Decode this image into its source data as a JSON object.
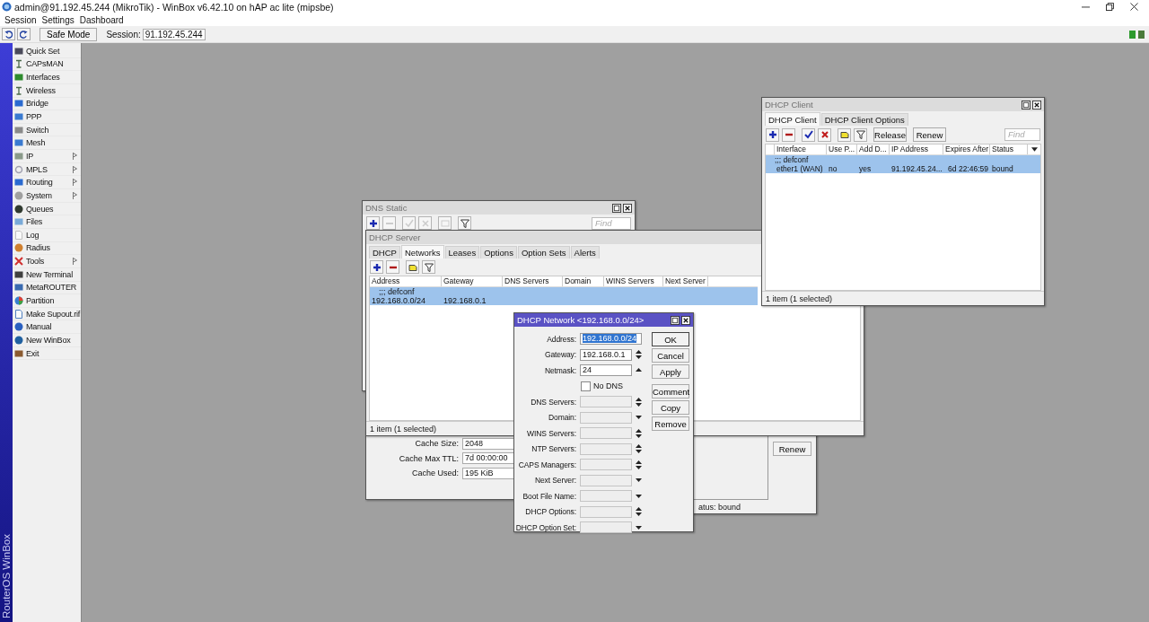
{
  "app": {
    "title": "admin@91.192.45.244 (MikroTik) - WinBox v6.42.10 on hAP ac lite (mipsbe)",
    "menu": [
      "Session",
      "Settings",
      "Dashboard"
    ]
  },
  "toolbar": {
    "safe_mode": "Safe Mode",
    "session_label": "Session:",
    "session": "91.192.45.244"
  },
  "sidebar": {
    "brand": "RouterOS WinBox",
    "items": [
      {
        "label": "Quick Set",
        "submenu": false
      },
      {
        "label": "CAPsMAN",
        "submenu": false
      },
      {
        "label": "Interfaces",
        "submenu": false
      },
      {
        "label": "Wireless",
        "submenu": false
      },
      {
        "label": "Bridge",
        "submenu": false
      },
      {
        "label": "PPP",
        "submenu": false
      },
      {
        "label": "Switch",
        "submenu": false
      },
      {
        "label": "Mesh",
        "submenu": false
      },
      {
        "label": "IP",
        "submenu": true
      },
      {
        "label": "MPLS",
        "submenu": true
      },
      {
        "label": "Routing",
        "submenu": true
      },
      {
        "label": "System",
        "submenu": true
      },
      {
        "label": "Queues",
        "submenu": false
      },
      {
        "label": "Files",
        "submenu": false
      },
      {
        "label": "Log",
        "submenu": false
      },
      {
        "label": "Radius",
        "submenu": false
      },
      {
        "label": "Tools",
        "submenu": true
      },
      {
        "label": "New Terminal",
        "submenu": false
      },
      {
        "label": "MetaROUTER",
        "submenu": false
      },
      {
        "label": "Partition",
        "submenu": false
      },
      {
        "label": "Make Supout.rif",
        "submenu": false
      },
      {
        "label": "Manual",
        "submenu": false
      },
      {
        "label": "New WinBox",
        "submenu": false
      },
      {
        "label": "Exit",
        "submenu": false
      }
    ]
  },
  "dns_static": {
    "title": "DNS Static",
    "active": false,
    "find_placeholder": "Find"
  },
  "dns_settings": {
    "fields": [
      {
        "label": "Cache Size:",
        "value": "2048"
      },
      {
        "label": "Cache Max TTL:",
        "value": "7d 00:00:00"
      },
      {
        "label": "Cache Used:",
        "value": "195 KiB"
      }
    ]
  },
  "client_detail": {
    "button": "Renew",
    "status": "atus: bound"
  },
  "dhcp_server": {
    "title": "DHCP Server",
    "active": false,
    "tabs": [
      {
        "label": "DHCP",
        "selected": false
      },
      {
        "label": "Networks",
        "selected": true
      },
      {
        "label": "Leases",
        "selected": false
      },
      {
        "label": "Options",
        "selected": false
      },
      {
        "label": "Option Sets",
        "selected": false
      },
      {
        "label": "Alerts",
        "selected": false
      }
    ],
    "columns": [
      "Address",
      "Gateway",
      "DNS Servers",
      "Domain",
      "WINS Servers",
      "Next Server"
    ],
    "rows": [
      {
        "kind": "comment",
        "text": ";;; defconf",
        "selected": true
      },
      {
        "kind": "data",
        "cells": [
          "192.168.0.0/24",
          "192.168.0.1"
        ],
        "selected": true
      }
    ],
    "status": "1 item (1 selected)"
  },
  "dhcp_client": {
    "title": "DHCP Client",
    "active": false,
    "tabs": [
      {
        "label": "DHCP Client",
        "selected": true
      },
      {
        "label": "DHCP Client Options",
        "selected": false
      }
    ],
    "buttons": [
      "Release",
      "Renew"
    ],
    "find_placeholder": "Find",
    "columns": [
      "Interface",
      "Use P...",
      "Add D...",
      "IP Address",
      "Expires After",
      "Status"
    ],
    "rows": [
      {
        "kind": "comment",
        "text": ";;; defconf",
        "selected": true
      },
      {
        "kind": "data",
        "cells": [
          "ether1 (WAN)",
          "no",
          "yes",
          "91.192.45.24...",
          "6d 22:46:59",
          "bound"
        ],
        "selected": true
      }
    ],
    "status": "1 item (1 selected)"
  },
  "dhcp_network": {
    "title": "DHCP Network <192.168.0.0/24>",
    "active": true,
    "fields": [
      {
        "kind": "field",
        "label": "Address:",
        "value": "192.168.0.0/24",
        "value_selected": true,
        "disabled": false,
        "arrow_up": false,
        "arrow_down": false
      },
      {
        "kind": "field",
        "label": "Gateway:",
        "value": "192.168.0.1",
        "value_selected": false,
        "disabled": false,
        "arrow_up": true,
        "arrow_down": true
      },
      {
        "kind": "field",
        "label": "Netmask:",
        "value": "24",
        "value_selected": false,
        "disabled": false,
        "arrow_up": true,
        "arrow_down": false
      },
      {
        "kind": "checkbox",
        "label": "No DNS",
        "checked": false
      },
      {
        "kind": "field",
        "label": "DNS Servers:",
        "disabled": true,
        "arrow_up": true,
        "arrow_down": true
      },
      {
        "kind": "field",
        "label": "Domain:",
        "disabled": true,
        "arrow_up": false,
        "arrow_down": true
      },
      {
        "kind": "field",
        "label": "WINS Servers:",
        "disabled": true,
        "arrow_up": true,
        "arrow_down": true
      },
      {
        "kind": "field",
        "label": "NTP Servers:",
        "disabled": true,
        "arrow_up": true,
        "arrow_down": true
      },
      {
        "kind": "field",
        "label": "CAPS Managers:",
        "disabled": true,
        "arrow_up": true,
        "arrow_down": true
      },
      {
        "kind": "field",
        "label": "Next Server:",
        "disabled": true,
        "arrow_up": false,
        "arrow_down": true
      },
      {
        "kind": "field",
        "label": "Boot File Name:",
        "disabled": true,
        "arrow_up": false,
        "arrow_down": true
      },
      {
        "kind": "field",
        "label": "DHCP Options:",
        "disabled": true,
        "arrow_up": true,
        "arrow_down": true
      },
      {
        "kind": "field",
        "label": "DHCP Option Set:",
        "disabled": true,
        "arrow_up": false,
        "arrow_down": true
      }
    ],
    "buttons": [
      "OK",
      "Cancel",
      "Apply",
      "Comment",
      "Copy",
      "Remove"
    ]
  }
}
